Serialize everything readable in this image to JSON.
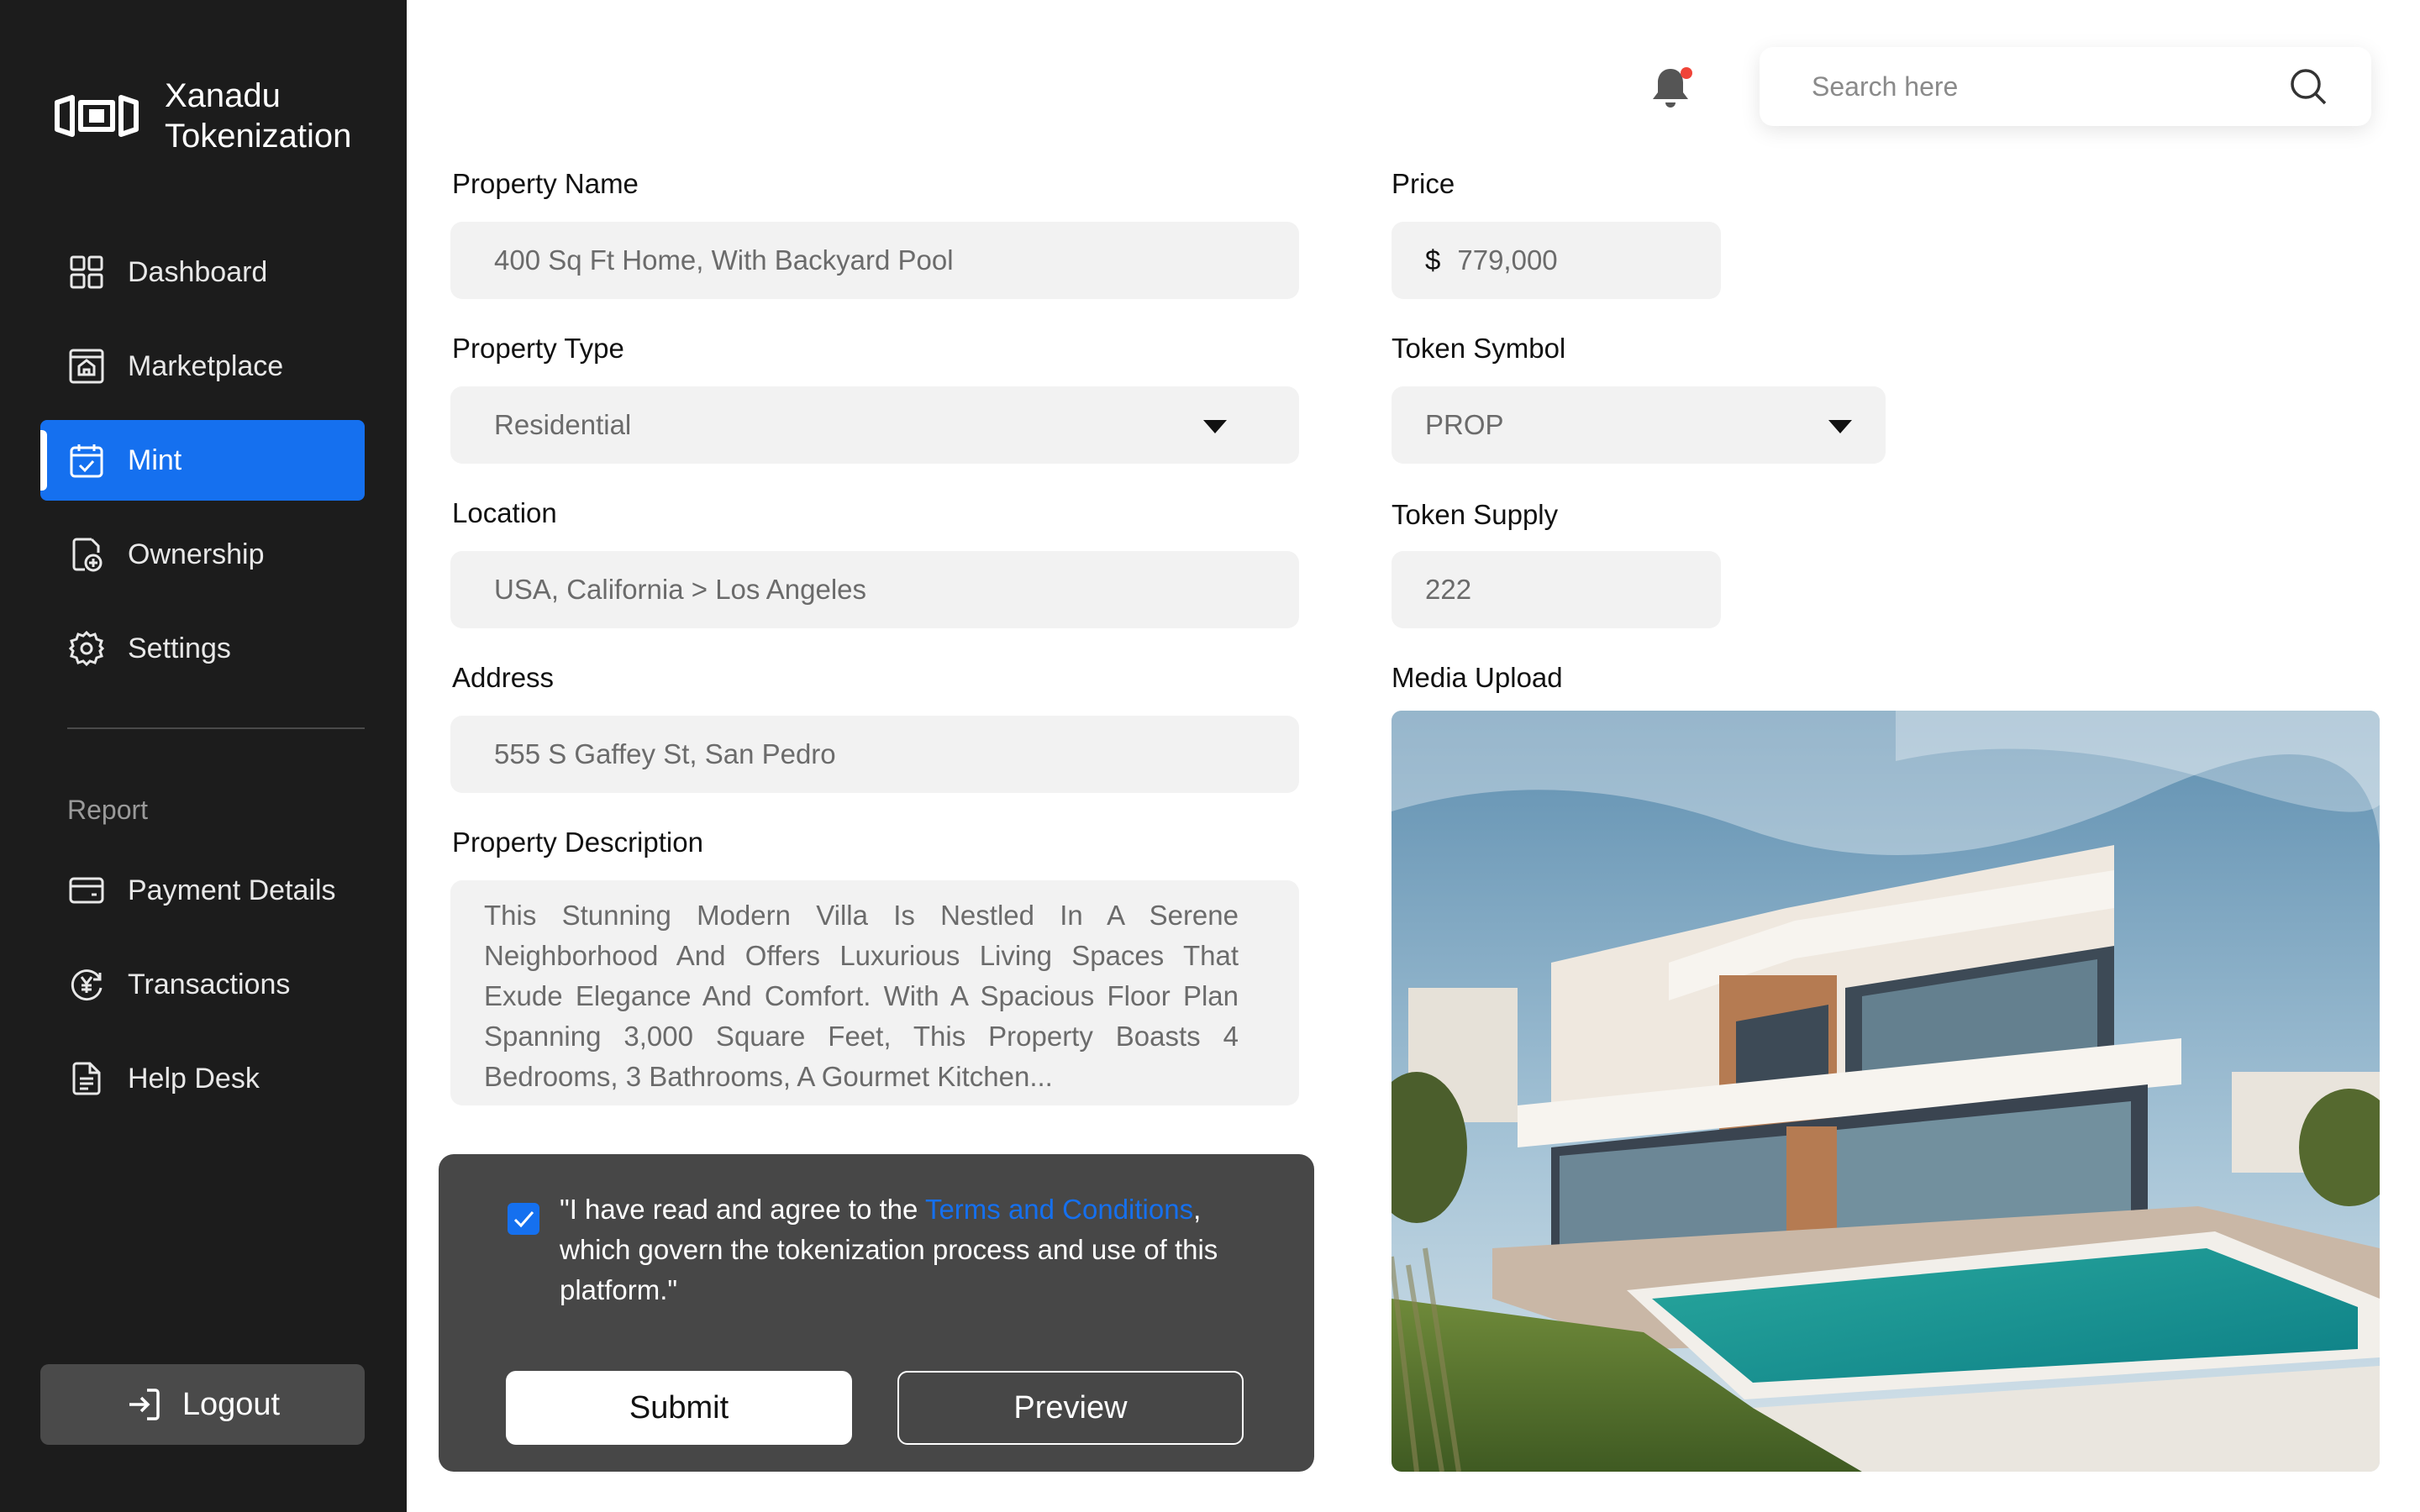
{
  "app": {
    "brand_line1": "Xanadu",
    "brand_line2": "Tokenization"
  },
  "sidebar": {
    "items": [
      {
        "label": "Dashboard",
        "icon": "grid-icon"
      },
      {
        "label": "Marketplace",
        "icon": "marketplace-icon"
      },
      {
        "label": "Mint",
        "icon": "calendar-check-icon",
        "active": true
      },
      {
        "label": "Ownership",
        "icon": "document-plus-icon"
      },
      {
        "label": "Settings",
        "icon": "gear-icon"
      }
    ],
    "report_label": "Report",
    "report_items": [
      {
        "label": "Payment Details",
        "icon": "wallet-icon"
      },
      {
        "label": "Transactions",
        "icon": "currency-cycle-icon"
      },
      {
        "label": "Help Desk",
        "icon": "document-icon"
      }
    ],
    "logout_label": "Logout"
  },
  "topbar": {
    "search_placeholder": "Search here",
    "notification_dot_color": "#f04438"
  },
  "form": {
    "property_name": {
      "label": "Property Name",
      "value": "400 Sq Ft Home, With Backyard Pool"
    },
    "property_type": {
      "label": "Property Type",
      "value": "Residential"
    },
    "location": {
      "label": "Location",
      "value": "USA, California > Los Angeles"
    },
    "address": {
      "label": "Address",
      "value": "555 S Gaffey St, San Pedro"
    },
    "description": {
      "label": "Property Description",
      "value": "This Stunning Modern Villa Is Nestled In A Serene Neighborhood And Offers Luxurious Living Spaces That Exude Elegance And Comfort. With A Spacious Floor Plan Spanning 3,000 Square Feet, This Property Boasts 4 Bedrooms, 3 Bathrooms, A Gourmet Kitchen..."
    },
    "price": {
      "label": "Price",
      "currency": "$",
      "value": "779,000"
    },
    "token_symbol": {
      "label": "Token Symbol",
      "value": "PROP"
    },
    "token_supply": {
      "label": "Token Supply",
      "value": "222"
    },
    "media_upload": {
      "label": "Media Upload"
    }
  },
  "terms": {
    "checked": true,
    "text_before": "\"I have read and agree to the ",
    "link_text": "Terms and Conditions",
    "text_after": ", which govern the tokenization process and use of this platform.\"",
    "submit_label": "Submit",
    "preview_label": "Preview"
  },
  "colors": {
    "accent": "#1570ef",
    "sidebar_bg": "#1c1c1c",
    "panel_bg": "#474747",
    "field_bg": "#f2f2f2"
  }
}
